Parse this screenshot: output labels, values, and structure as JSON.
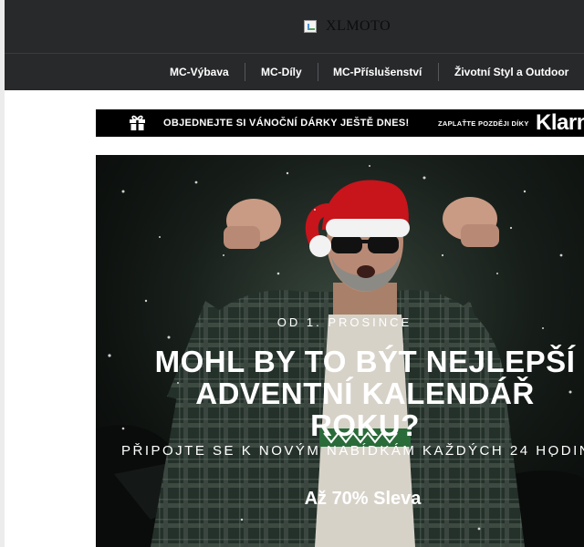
{
  "header": {
    "logo_alt": "XLMOTO"
  },
  "nav": {
    "items": [
      {
        "label": "MC-Výbava"
      },
      {
        "label": "MC-Díly"
      },
      {
        "label": "MC-Příslušenství"
      },
      {
        "label": "Životní Styl a Outdoor"
      }
    ]
  },
  "promo": {
    "text": "OBJEDNEJTE SI VÁNOČNÍ DÁRKY JEŠTĚ DNES!",
    "pay_later": "ZAPLAŤTE POZDĚJI DÍKY",
    "brand": "Klarna"
  },
  "hero": {
    "eyebrow": "OD 1. PROSINCE",
    "title_lines": [
      "MOHL BY TO BÝT NEJLEPŠÍ",
      "ADVENTNÍ KALENDÁŘ",
      "ROKU?"
    ],
    "subtitle": "PŘIPOJTE SE K NOVÝM NABÍDKÁM KAŽDÝCH 24 HODIN",
    "discount": "Až 70% Sleva"
  },
  "colors": {
    "header_bg": "#28292b",
    "promo_bg": "#000000",
    "hero_bg": "#161d19",
    "santa_hat": "#c8141b"
  }
}
